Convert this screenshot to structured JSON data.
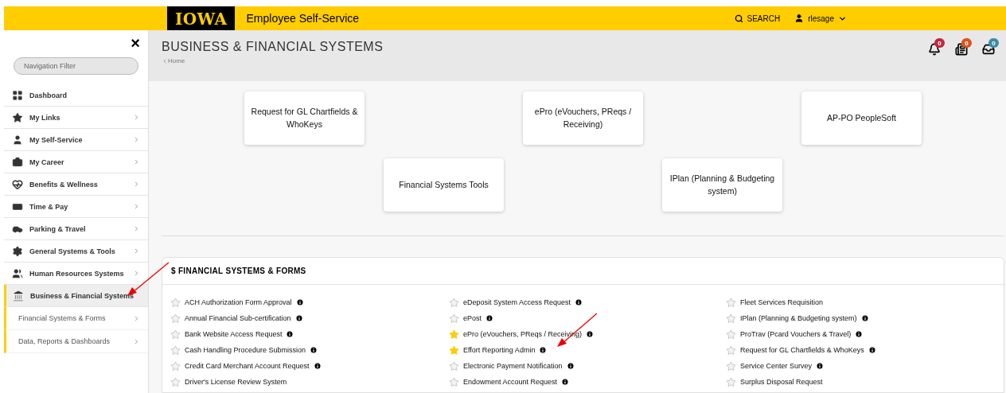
{
  "topbar": {
    "logo": "IOWA",
    "title": "Employee Self-Service",
    "search": "SEARCH",
    "user": "rlesage"
  },
  "sidebar": {
    "close": "×",
    "filter_placeholder": "Navigation Filter",
    "items": [
      {
        "label": "Dashboard",
        "chevron": false,
        "selected": false
      },
      {
        "label": "My Links",
        "chevron": true,
        "selected": false
      },
      {
        "label": "My Self-Service",
        "chevron": true,
        "selected": false
      },
      {
        "label": "My Career",
        "chevron": true,
        "selected": false
      },
      {
        "label": "Benefits & Wellness",
        "chevron": true,
        "selected": false
      },
      {
        "label": "Time & Pay",
        "chevron": true,
        "selected": false
      },
      {
        "label": "Parking & Travel",
        "chevron": true,
        "selected": false
      },
      {
        "label": "General Systems & Tools",
        "chevron": true,
        "selected": false
      },
      {
        "label": "Human Resources Systems",
        "chevron": true,
        "selected": false
      },
      {
        "label": "Business & Financial Systems",
        "chevron": false,
        "selected": true,
        "children": [
          {
            "label": "Financial Systems & Forms",
            "selected": false
          },
          {
            "label": "Data, Reports & Dashboards",
            "selected": false
          }
        ]
      }
    ]
  },
  "header": {
    "title": "BUSINESS & FINANCIAL SYSTEMS",
    "breadcrumb": "Home",
    "badges": [
      {
        "count": "0",
        "color": "#c0283e"
      },
      {
        "count": "0",
        "color": "#d9531e"
      },
      {
        "count": "0",
        "color": "#3b8ba5"
      }
    ]
  },
  "tiles": [
    [
      "Request for GL Chartfields & WhoKeys",
      "ePro (eVouchers, PReqs / Receiving)",
      "AP-PO PeopleSoft"
    ],
    [
      "Financial Systems Tools",
      "IPlan (Planning & Budgeting system)"
    ]
  ],
  "section": {
    "title": "$ FINANCIAL SYSTEMS & FORMS",
    "columns": [
      [
        {
          "label": "ACH Authorization Form Approval",
          "favorite": false,
          "info": true
        },
        {
          "label": "Annual Financial Sub-certification",
          "favorite": false,
          "info": true
        },
        {
          "label": "Bank Website Access Request",
          "favorite": false,
          "info": true
        },
        {
          "label": "Cash Handling Procedure Submission",
          "favorite": false,
          "info": true
        },
        {
          "label": "Credit Card Merchant Account Request",
          "favorite": false,
          "info": true
        },
        {
          "label": "Driver's License Review System",
          "favorite": false,
          "info": false
        }
      ],
      [
        {
          "label": "eDeposit System Access Request",
          "favorite": false,
          "info": true
        },
        {
          "label": "ePost",
          "favorite": false,
          "info": true
        },
        {
          "label": "ePro (eVouchers, PReqs / Receiving)",
          "favorite": true,
          "info": true
        },
        {
          "label": "Effort Reporting Admin",
          "favorite": true,
          "info": true
        },
        {
          "label": "Electronic Payment Notification",
          "favorite": false,
          "info": true
        },
        {
          "label": "Endowment Account Request",
          "favorite": false,
          "info": true
        }
      ],
      [
        {
          "label": "Fleet Services Requisition",
          "favorite": false,
          "info": false
        },
        {
          "label": "IPlan (Planning & Budgeting system)",
          "favorite": false,
          "info": true
        },
        {
          "label": "ProTrav (Pcard Vouchers & Travel)",
          "favorite": false,
          "info": true
        },
        {
          "label": "Request for GL Chartfields & WhoKeys",
          "favorite": false,
          "info": true
        },
        {
          "label": "Service Center Survey",
          "favorite": false,
          "info": true
        },
        {
          "label": "Surplus Disposal Request",
          "favorite": false,
          "info": false
        }
      ]
    ]
  }
}
